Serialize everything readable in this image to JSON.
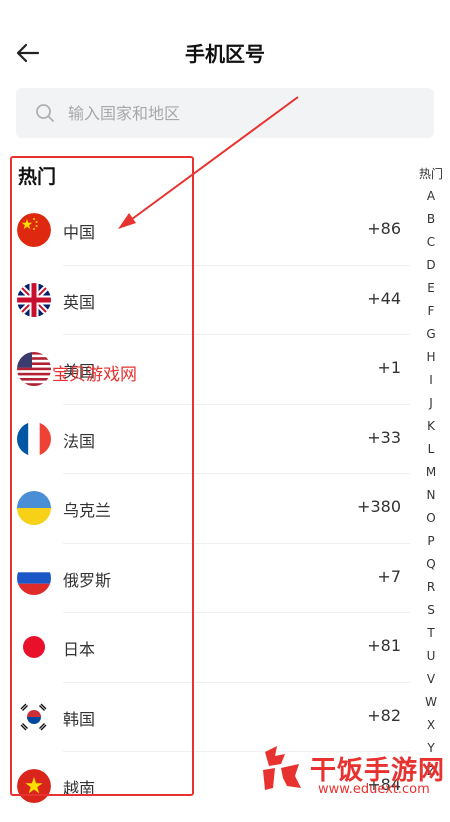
{
  "header": {
    "title": "手机区号",
    "back_icon": "arrow-left-icon"
  },
  "search": {
    "placeholder": "输入国家和地区",
    "value": "",
    "icon": "search-icon"
  },
  "section": {
    "title": "热门"
  },
  "countries": [
    {
      "name": "中国",
      "code": "+86",
      "flag": "china"
    },
    {
      "name": "英国",
      "code": "+44",
      "flag": "uk"
    },
    {
      "name": "美国",
      "code": "+1",
      "flag": "usa"
    },
    {
      "name": "法国",
      "code": "+33",
      "flag": "france"
    },
    {
      "name": "乌克兰",
      "code": "+380",
      "flag": "ukraine"
    },
    {
      "name": "俄罗斯",
      "code": "+7",
      "flag": "russia"
    },
    {
      "name": "日本",
      "code": "+81",
      "flag": "japan"
    },
    {
      "name": "韩国",
      "code": "+82",
      "flag": "korea"
    },
    {
      "name": "越南",
      "code": "+84",
      "flag": "vietnam"
    }
  ],
  "index_bar": {
    "hot": "热门",
    "letters": [
      "A",
      "B",
      "C",
      "D",
      "E",
      "F",
      "G",
      "H",
      "I",
      "J",
      "K",
      "L",
      "M",
      "N",
      "O",
      "P",
      "Q",
      "R",
      "S",
      "T",
      "U",
      "V",
      "W",
      "X",
      "Y",
      "Z"
    ]
  },
  "watermarks": {
    "mid": "宝贝游戏网",
    "brand": "干饭手游网",
    "url": "www.eduext.com"
  },
  "colors": {
    "annotation": "#e8322f",
    "search_bg": "#f2f3f5"
  }
}
